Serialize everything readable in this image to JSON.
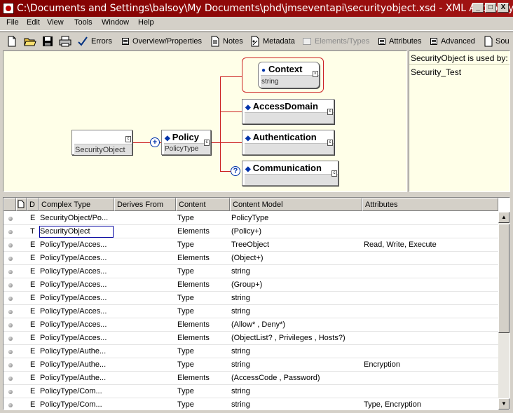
{
  "window": {
    "title": "C:\\Documents and Settings\\balsoy\\My Documents\\phd\\jmseventapi\\securityobject.xsd - XML Authority",
    "min": "_",
    "max": "□",
    "close": "X"
  },
  "menu": [
    "File",
    "Edit",
    "View",
    "Tools",
    "Window",
    "Help"
  ],
  "toolbar": {
    "errors": "Errors",
    "overview": "Overview/Properties",
    "notes": "Notes",
    "metadata": "Metadata",
    "elements_types": "Elements/Types",
    "attributes": "Attributes",
    "advanced": "Advanced",
    "source": "Sou"
  },
  "diagram": {
    "root": {
      "label": "SecurityObject"
    },
    "policy": {
      "label": "Policy",
      "type": "PolicyType"
    },
    "context": {
      "label": "Context",
      "type": "string"
    },
    "access_domain": {
      "label": "AccessDomain"
    },
    "authentication": {
      "label": "Authentication"
    },
    "communication": {
      "label": "Communication"
    },
    "sequence_symbol": "+",
    "optional_symbol": "?"
  },
  "usedby": {
    "header": "SecurityObject is used by:",
    "items": [
      "Security_Test"
    ]
  },
  "table": {
    "headers": [
      "",
      "D",
      "Complex Type",
      "Derives From",
      "Content",
      "Content Model",
      "Attributes"
    ],
    "rows": [
      {
        "d": "E",
        "type": "SecurityObject/Po...",
        "derives": "",
        "content": "Type",
        "model": "PolicyType",
        "attrs": ""
      },
      {
        "d": "T",
        "type": "SecurityObject",
        "derives": "",
        "content": "Elements",
        "model": "(Policy+)",
        "attrs": ""
      },
      {
        "d": "E",
        "type": "PolicyType/Acces...",
        "derives": "",
        "content": "Type",
        "model": "TreeObject",
        "attrs": "Read, Write, Execute"
      },
      {
        "d": "E",
        "type": "PolicyType/Acces...",
        "derives": "",
        "content": "Elements",
        "model": "(Object+)",
        "attrs": ""
      },
      {
        "d": "E",
        "type": "PolicyType/Acces...",
        "derives": "",
        "content": "Type",
        "model": "string",
        "attrs": ""
      },
      {
        "d": "E",
        "type": "PolicyType/Acces...",
        "derives": "",
        "content": "Elements",
        "model": "(Group+)",
        "attrs": ""
      },
      {
        "d": "E",
        "type": "PolicyType/Acces...",
        "derives": "",
        "content": "Type",
        "model": "string",
        "attrs": ""
      },
      {
        "d": "E",
        "type": "PolicyType/Acces...",
        "derives": "",
        "content": "Type",
        "model": "string",
        "attrs": ""
      },
      {
        "d": "E",
        "type": "PolicyType/Acces...",
        "derives": "",
        "content": "Elements",
        "model": "(Allow* , Deny*)",
        "attrs": ""
      },
      {
        "d": "E",
        "type": "PolicyType/Acces...",
        "derives": "",
        "content": "Elements",
        "model": "(ObjectList? , Privileges , Hosts?)",
        "attrs": ""
      },
      {
        "d": "E",
        "type": "PolicyType/Authe...",
        "derives": "",
        "content": "Type",
        "model": "string",
        "attrs": ""
      },
      {
        "d": "E",
        "type": "PolicyType/Authe...",
        "derives": "",
        "content": "Type",
        "model": "string",
        "attrs": "Encryption"
      },
      {
        "d": "E",
        "type": "PolicyType/Authe...",
        "derives": "",
        "content": "Elements",
        "model": "(AccessCode , Password)",
        "attrs": ""
      },
      {
        "d": "E",
        "type": "PolicyType/Com...",
        "derives": "",
        "content": "Type",
        "model": "string",
        "attrs": ""
      },
      {
        "d": "E",
        "type": "PolicyType/Com...",
        "derives": "",
        "content": "Type",
        "model": "string",
        "attrs": "Type, Encryption"
      }
    ],
    "selected_row": 1
  }
}
